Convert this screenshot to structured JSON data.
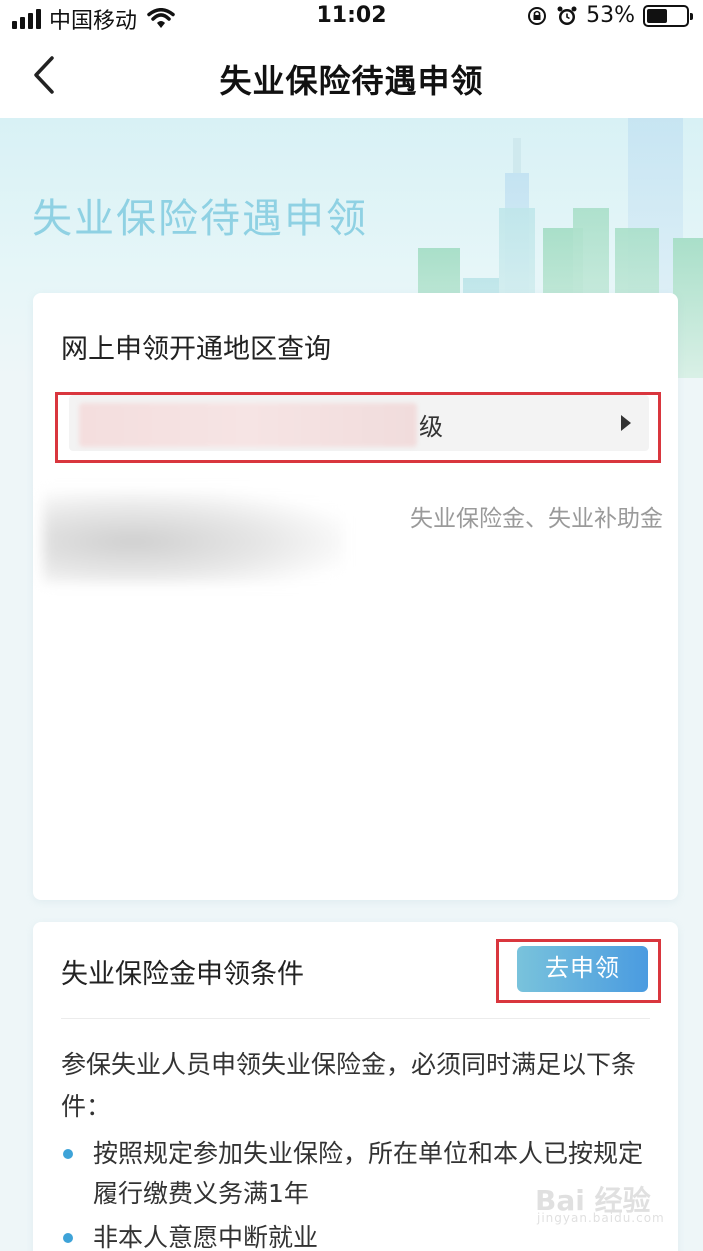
{
  "status_bar": {
    "carrier": "中国移动",
    "time": "11:02",
    "battery": "53%",
    "battery_level": 0.53
  },
  "nav": {
    "title": "失业保险待遇申领"
  },
  "banner": {
    "title": "失业保险待遇申领"
  },
  "region_card": {
    "heading": "网上申领开通地区查询",
    "region_value": "级",
    "result_text": "失业保险金、失业补助金"
  },
  "conditions_card": {
    "heading": "失业保险金申领条件",
    "apply_button": "去申领",
    "intro": "参保失业人员申领失业保险金，必须同时满足以下条件：",
    "bullets": [
      "按照规定参加失业保险，所在单位和本人已按规定履行缴费义务满1年",
      "非本人意愿中断就业"
    ]
  },
  "watermark": {
    "text": "Bai 经验",
    "sub": "jingyan.baidu.com"
  },
  "colors": {
    "accent": "#4a9be0",
    "banner_title": "#8fd1e3",
    "highlight": "#d9363e"
  }
}
